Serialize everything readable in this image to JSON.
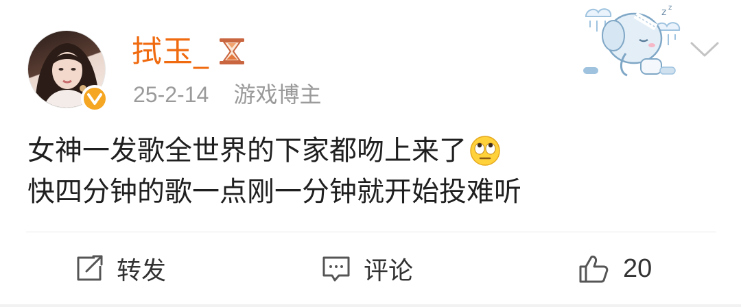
{
  "post": {
    "username": "拭玉_",
    "date": "25-2-14",
    "user_tag": "游戏博主",
    "content_line1": "女神一发歌全世界的下家都吻上来了",
    "content_line2": "快四分钟的歌一点刚一分钟就开始投难听",
    "icons": {
      "avatar": "avatar",
      "verified": "verified-badge-icon",
      "hourglass": "hourglass-icon",
      "sticker": "sleeping-elephant-sticker",
      "chevron": "chevron-down-icon",
      "emoji": "eye-roll-emoji"
    }
  },
  "actions": {
    "repost_label": "转发",
    "comment_label": "评论",
    "like_count": "20"
  },
  "colors": {
    "username": "#f06a0f",
    "meta": "#9a9a9a",
    "verified": "#f5a623",
    "divider": "#e8e8e8"
  }
}
